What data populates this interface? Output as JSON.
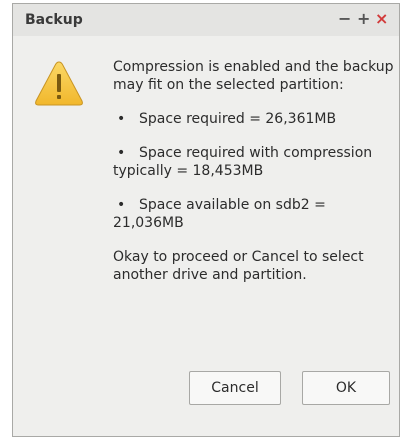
{
  "window": {
    "title": "Backup",
    "minimize_glyph": "−",
    "maximize_glyph": "+",
    "close_glyph": "×"
  },
  "icon": "warning-icon",
  "message": {
    "intro": "Compression is enabled and the backup may fit on the selected partition:",
    "bullet_glyph": "•",
    "bullets": [
      "Space required = 26,361MB",
      "Space required with compression typically = 18,453MB",
      "Space available on sdb2 = 21,036MB"
    ],
    "outro": "Okay to proceed or Cancel to select another drive and partition."
  },
  "buttons": {
    "cancel": "Cancel",
    "ok": "OK"
  },
  "colors": {
    "warning_fill": "#f7c948",
    "close_glyph": "#d23b3b"
  }
}
